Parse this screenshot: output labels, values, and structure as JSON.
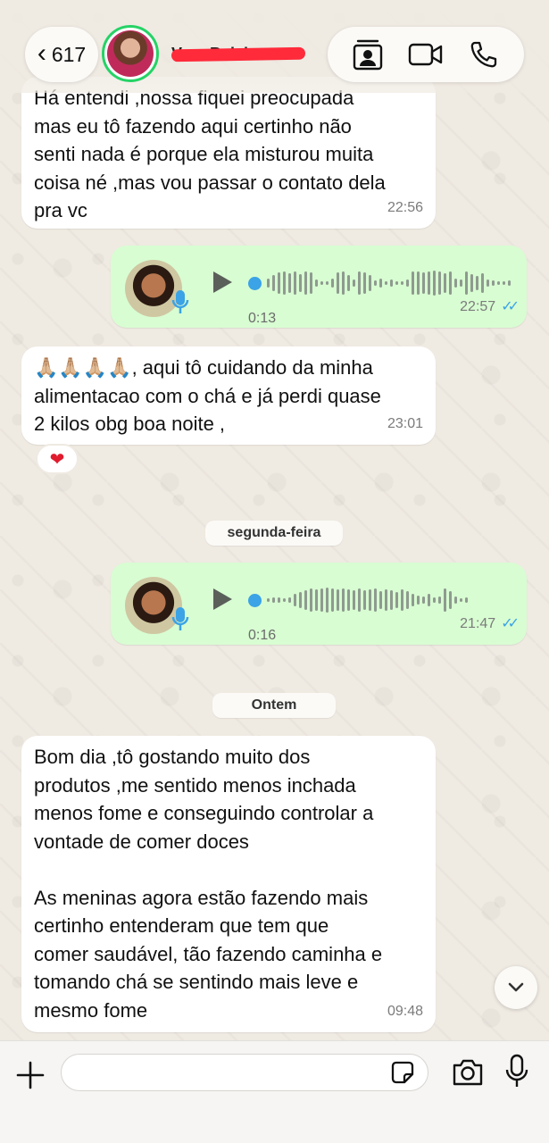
{
  "header": {
    "back_count": "617",
    "back_chevron": "‹",
    "contact_name": "Vera Baleira",
    "icons": [
      "contact-card-icon",
      "video-call-icon",
      "phone-call-icon"
    ]
  },
  "messages": [
    {
      "type": "text",
      "direction": "in",
      "text": "Há entendi ,nossa fiquei preocupada\nmas eu tô fazendo aqui certinho não\nsenti nada é porque ela misturou muita\ncoisa né ,mas vou passar o contato dela\npra vc",
      "time": "22:56"
    },
    {
      "type": "audio",
      "direction": "out",
      "duration": "0:13",
      "time": "22:57",
      "read": true
    },
    {
      "type": "text",
      "direction": "in",
      "text": "🙏🏼🙏🏼🙏🏼🙏🏼, aqui tô cuidando da minha\nalimentacao com o chá e já perdi quase\n2 kilos obg boa noite ,",
      "time": "23:01",
      "reaction": "❤"
    },
    {
      "type": "date",
      "label": "segunda-feira"
    },
    {
      "type": "audio",
      "direction": "out",
      "duration": "0:16",
      "time": "21:47",
      "read": true
    },
    {
      "type": "date",
      "label": "Ontem"
    },
    {
      "type": "text",
      "direction": "in",
      "text": "Bom dia ,tô gostando muito dos\nprodutos ,me sentido menos inchada\nmenos fome e conseguindo controlar a\nvontade de comer doces\n\nAs meninas agora estão fazendo mais\ncertinho entenderam que tem que\ncomer saudável, tão fazendo caminha e\ntomando chá se sentindo mais leve e\nmesmo fome",
      "time": "09:48"
    }
  ],
  "input": {
    "placeholder": "",
    "value": ""
  },
  "colors": {
    "incoming": "#ffffff",
    "outgoing": "#d8fdd2",
    "read_ticks": "#3ba3e6",
    "background": "#efeae2",
    "status_ring": "#25d366"
  }
}
